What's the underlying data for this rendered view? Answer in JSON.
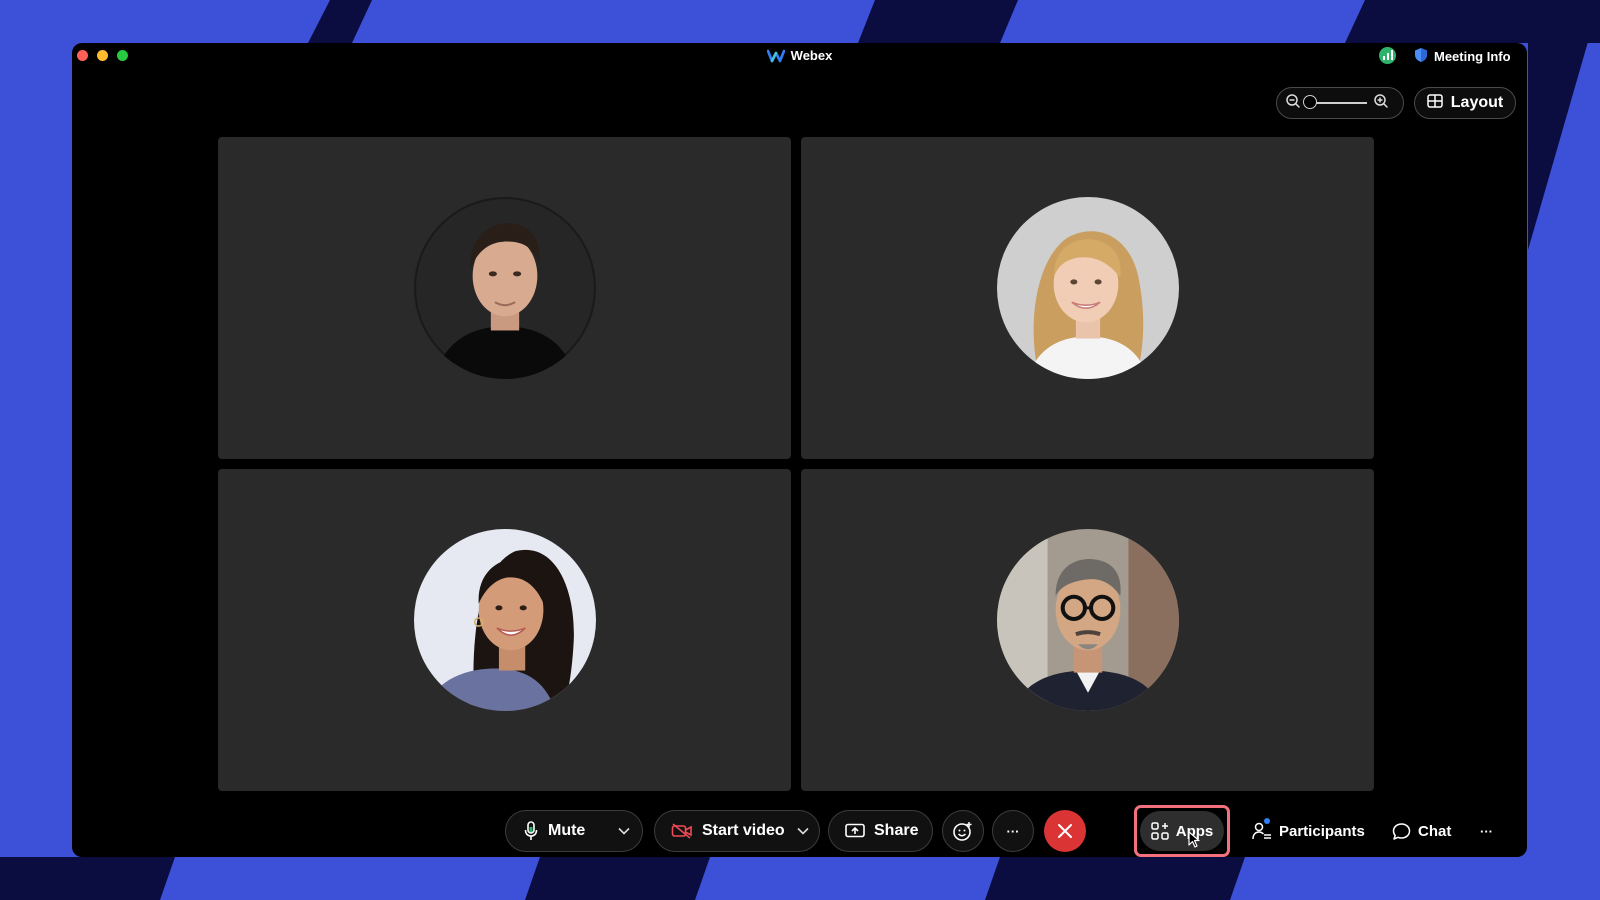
{
  "window": {
    "title": "Webex",
    "meeting_info_label": "Meeting Info"
  },
  "view_controls": {
    "layout_label": "Layout",
    "zoom_level": 0.0
  },
  "participants_grid": [
    {
      "avatar": "avatar-man-dark-hair"
    },
    {
      "avatar": "avatar-woman-blonde-hair"
    },
    {
      "avatar": "avatar-woman-dark-hair"
    },
    {
      "avatar": "avatar-man-glasses"
    }
  ],
  "toolbar": {
    "mute_label": "Mute",
    "start_video_label": "Start video",
    "share_label": "Share",
    "more_label": "···",
    "apps_label": "Apps",
    "participants_label": "Participants",
    "chat_label": "Chat",
    "overflow_label": "···"
  },
  "colors": {
    "background_blue": "#3d50d8",
    "background_navy": "#0b0c3f",
    "end_call_red": "#db3434",
    "highlight": "#f3707c"
  },
  "icons": [
    "webex-logo-icon",
    "network-signal-icon",
    "shield-icon",
    "zoom-out-icon",
    "zoom-in-icon",
    "layout-grid-icon",
    "microphone-icon",
    "chevron-down-icon",
    "video-off-icon",
    "share-screen-icon",
    "reactions-icon",
    "end-call-icon",
    "apps-icon",
    "mouse-cursor-icon",
    "participants-icon",
    "chat-icon"
  ]
}
